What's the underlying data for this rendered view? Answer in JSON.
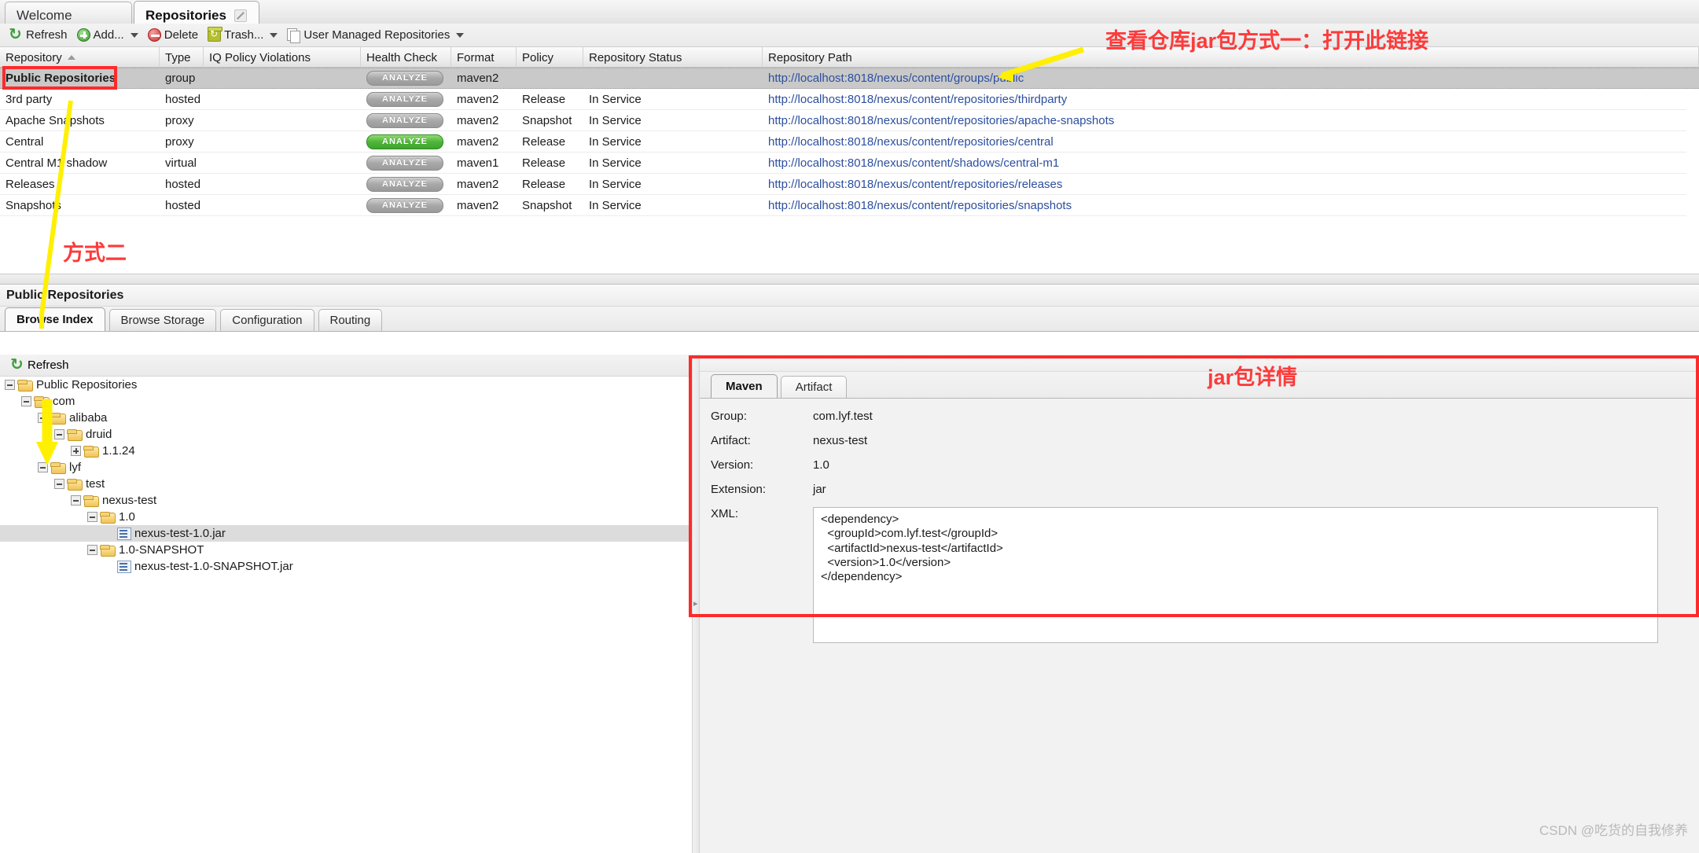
{
  "window": {
    "tabs": [
      {
        "label": "Welcome",
        "active": false,
        "closable": false
      },
      {
        "label": "Repositories",
        "active": true,
        "closable": true
      }
    ]
  },
  "toolbar": {
    "items": [
      {
        "label": "Refresh",
        "icon": "refresh-icon",
        "caret": false
      },
      {
        "label": "Add...",
        "icon": "add-icon",
        "caret": true
      },
      {
        "label": "Delete",
        "icon": "delete-icon",
        "caret": false
      },
      {
        "label": "Trash...",
        "icon": "trash-icon",
        "caret": true
      },
      {
        "label": "User Managed Repositories",
        "icon": "documents-icon",
        "caret": true
      }
    ]
  },
  "grid": {
    "columns": [
      {
        "label": "Repository",
        "sort": "asc"
      },
      {
        "label": "Type"
      },
      {
        "label": "IQ Policy Violations"
      },
      {
        "label": "Health Check"
      },
      {
        "label": "Format"
      },
      {
        "label": "Policy"
      },
      {
        "label": "Repository Status"
      },
      {
        "label": "Repository Path"
      }
    ],
    "rows": [
      {
        "repository": "Public Repositories",
        "type": "group",
        "iq": "",
        "health": "ANALYZE",
        "health_state": "grey",
        "format": "maven2",
        "policy": "",
        "status": "",
        "path": "http://localhost:8018/nexus/content/groups/public",
        "selected": true
      },
      {
        "repository": "3rd party",
        "type": "hosted",
        "iq": "",
        "health": "ANALYZE",
        "health_state": "grey",
        "format": "maven2",
        "policy": "Release",
        "status": "In Service",
        "path": "http://localhost:8018/nexus/content/repositories/thirdparty",
        "selected": false
      },
      {
        "repository": "Apache Snapshots",
        "type": "proxy",
        "iq": "",
        "health": "ANALYZE",
        "health_state": "grey",
        "format": "maven2",
        "policy": "Snapshot",
        "status": "In Service",
        "path": "http://localhost:8018/nexus/content/repositories/apache-snapshots",
        "selected": false
      },
      {
        "repository": "Central",
        "type": "proxy",
        "iq": "",
        "health": "ANALYZE",
        "health_state": "green",
        "format": "maven2",
        "policy": "Release",
        "status": "In Service",
        "path": "http://localhost:8018/nexus/content/repositories/central",
        "selected": false
      },
      {
        "repository": "Central M1 shadow",
        "type": "virtual",
        "iq": "",
        "health": "ANALYZE",
        "health_state": "grey",
        "format": "maven1",
        "policy": "Release",
        "status": "In Service",
        "path": "http://localhost:8018/nexus/content/shadows/central-m1",
        "selected": false
      },
      {
        "repository": "Releases",
        "type": "hosted",
        "iq": "",
        "health": "ANALYZE",
        "health_state": "grey",
        "format": "maven2",
        "policy": "Release",
        "status": "In Service",
        "path": "http://localhost:8018/nexus/content/repositories/releases",
        "selected": false
      },
      {
        "repository": "Snapshots",
        "type": "hosted",
        "iq": "",
        "health": "ANALYZE",
        "health_state": "grey",
        "format": "maven2",
        "policy": "Snapshot",
        "status": "In Service",
        "path": "http://localhost:8018/nexus/content/repositories/snapshots",
        "selected": false
      }
    ]
  },
  "bottom": {
    "title": "Public Repositories",
    "tabs": [
      {
        "label": "Browse Index",
        "active": true
      },
      {
        "label": "Browse Storage",
        "active": false
      },
      {
        "label": "Configuration",
        "active": false
      },
      {
        "label": "Routing",
        "active": false
      }
    ],
    "tree_toolbar": {
      "refresh_label": "Refresh"
    },
    "tree": [
      {
        "label": "Public Repositories",
        "depth": 0,
        "kind": "folder",
        "toggle": "minus",
        "selected": false
      },
      {
        "label": "com",
        "depth": 1,
        "kind": "folder",
        "toggle": "minus",
        "selected": false
      },
      {
        "label": "alibaba",
        "depth": 2,
        "kind": "folder",
        "toggle": "minus",
        "selected": false
      },
      {
        "label": "druid",
        "depth": 3,
        "kind": "folder",
        "toggle": "minus",
        "selected": false
      },
      {
        "label": "1.1.24",
        "depth": 4,
        "kind": "folder",
        "toggle": "plus",
        "selected": false
      },
      {
        "label": "lyf",
        "depth": 2,
        "kind": "folder",
        "toggle": "minus",
        "selected": false
      },
      {
        "label": "test",
        "depth": 3,
        "kind": "folder",
        "toggle": "minus",
        "selected": false
      },
      {
        "label": "nexus-test",
        "depth": 4,
        "kind": "folder",
        "toggle": "minus",
        "selected": false
      },
      {
        "label": "1.0",
        "depth": 5,
        "kind": "folder",
        "toggle": "minus",
        "selected": false
      },
      {
        "label": "nexus-test-1.0.jar",
        "depth": 6,
        "kind": "file",
        "toggle": "none",
        "selected": true
      },
      {
        "label": "1.0-SNAPSHOT",
        "depth": 5,
        "kind": "folder",
        "toggle": "minus",
        "selected": false
      },
      {
        "label": "nexus-test-1.0-SNAPSHOT.jar",
        "depth": 6,
        "kind": "file",
        "toggle": "none",
        "selected": false
      }
    ]
  },
  "detail": {
    "tabs": [
      {
        "label": "Maven",
        "active": true
      },
      {
        "label": "Artifact",
        "active": false
      }
    ],
    "fields": [
      {
        "label": "Group:",
        "value": "com.lyf.test"
      },
      {
        "label": "Artifact:",
        "value": "nexus-test"
      },
      {
        "label": "Version:",
        "value": "1.0"
      },
      {
        "label": "Extension:",
        "value": "jar"
      }
    ],
    "xml_label": "XML:",
    "xml_value": "<dependency>\n  <groupId>com.lyf.test</groupId>\n  <artifactId>nexus-test</artifactId>\n  <version>1.0</version>\n</dependency>"
  },
  "annotations": {
    "top_note": "查看仓库jar包方式一：打开此链接",
    "left_note": "方式二",
    "detail_note": "jar包详情",
    "watermark": "CSDN @吃货的自我修养",
    "colors": {
      "red": "#fc3b3b",
      "yellow": "#ffef00",
      "link": "#2c4f9e",
      "green": "#4fb53a"
    }
  }
}
